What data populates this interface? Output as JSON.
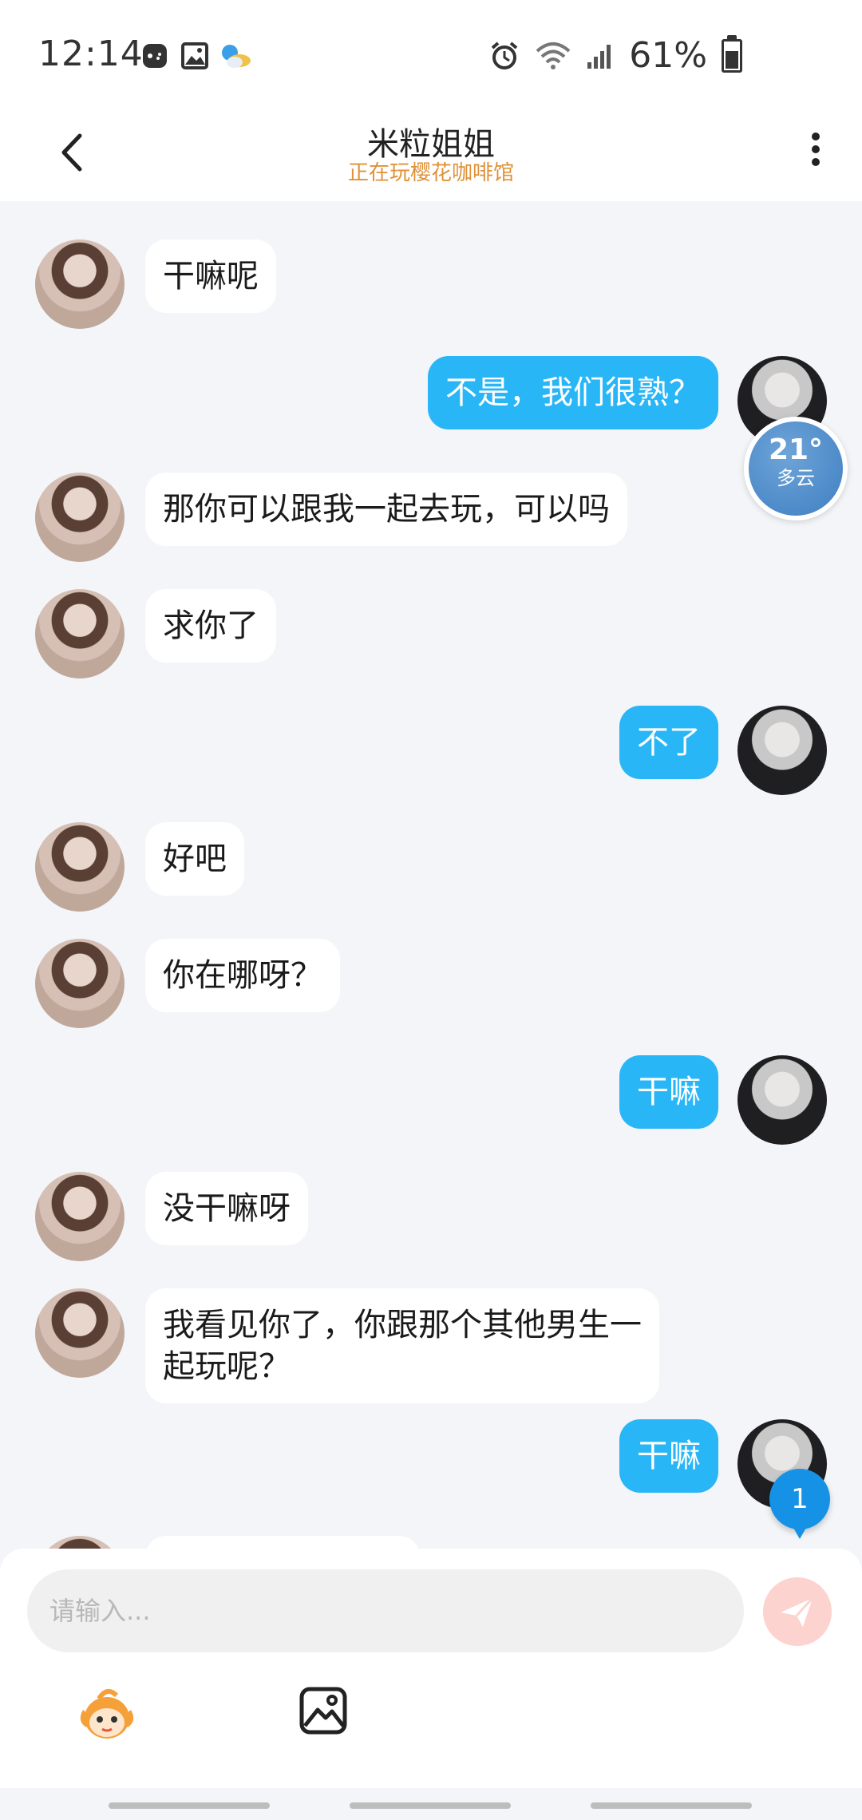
{
  "status_bar": {
    "time": "12:14",
    "battery": "61%",
    "battery_level": 0.61,
    "icons": [
      "game-notification-icon",
      "gallery-notification-icon",
      "weather-notification-icon",
      "alarm-icon",
      "wifi-icon",
      "signal-icon",
      "battery-icon"
    ]
  },
  "header": {
    "title": "米粒姐姐",
    "subtitle": "正在玩樱花咖啡馆"
  },
  "messages": [
    {
      "side": "in",
      "text": "干嘛呢"
    },
    {
      "side": "out",
      "text": "不是，我们很熟？"
    },
    {
      "side": "in",
      "text": "那你可以跟我一起去玩，可以吗"
    },
    {
      "side": "in",
      "text": "求你了"
    },
    {
      "side": "out",
      "text": "不了"
    },
    {
      "side": "in",
      "text": "好吧"
    },
    {
      "side": "in",
      "text": "你在哪呀？"
    },
    {
      "side": "out",
      "text": "干嘛"
    },
    {
      "side": "in",
      "text": "没干嘛呀"
    },
    {
      "side": "in",
      "text": "我看见你了，你跟那个其他男生一\n起玩呢？"
    },
    {
      "side": "out",
      "text": "干嘛"
    }
  ],
  "weather_widget": {
    "temp": "21°",
    "condition": "多云"
  },
  "unread_badge": "1",
  "input": {
    "placeholder": "请输入..."
  },
  "colors": {
    "outgoing_bubble": "#29b6f6",
    "subtitle": "#e09137",
    "send_button": "#fcd3cf",
    "unread": "#1592e6"
  }
}
